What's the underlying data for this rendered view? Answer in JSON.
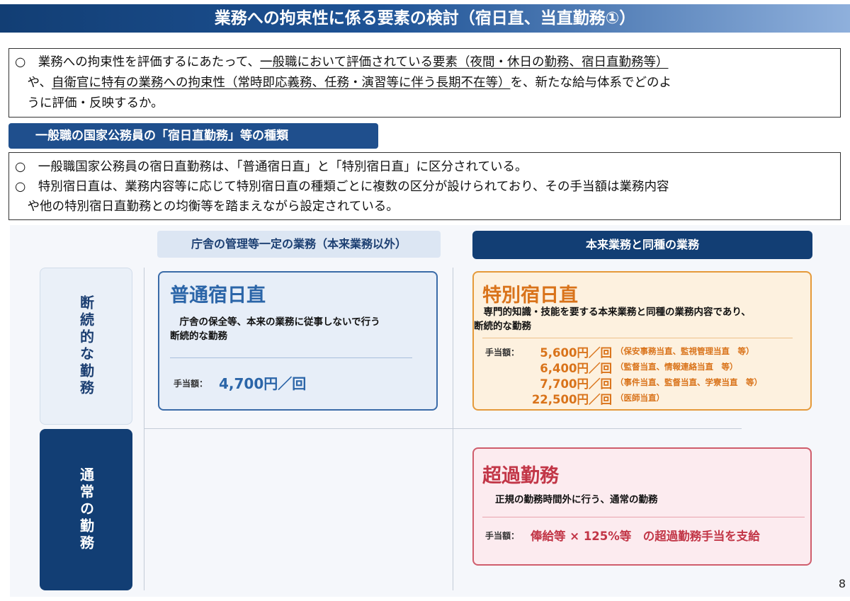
{
  "header": {
    "title": "業務への拘束性に係る要素の検討（宿日直、当直勤務①）"
  },
  "intro": {
    "line1_pre": "○　業務への拘束性を評価するにあたって、",
    "line1_underline": "一般職において評価されている要素（夜間・休日の勤務、宿日直勤務等）",
    "line2_pre": "　や、",
    "line2_underline": "自衛官に特有の業務への拘束性（常時即応義務、任務・演習等に伴う長期不在等）",
    "line2_post": "を、新たな給与体系でどのよ",
    "line3": "　うに評価・反映するか。"
  },
  "section": {
    "header": "一般職の国家公務員の「宿日直勤務」等の種類"
  },
  "info": {
    "line1": "○　一般職国家公務員の宿日直勤務は、「普通宿日直」と「特別宿日直」に区分されている。",
    "line2": "○　特別宿日直は、業務内容等に応じて特別宿日直の種類ごとに複数の区分が設けられており、その手当額は業務内容",
    "line3": "　や他の特別宿日直勤務との均衡等を踏まえながら設定されている。"
  },
  "matrix": {
    "col_left": "庁舎の管理等一定の業務（本来業務以外）",
    "col_right": "本来業務と同種の業務",
    "row_top": "断続的な勤務",
    "row_bottom": "通常の勤務"
  },
  "futsu": {
    "title": "普通宿日直",
    "desc1": "　庁舎の保全等、本来の業務に従事しないで行う",
    "desc2": "断続的な勤務",
    "allowance_label": "手当額：",
    "allowance_value": "4,700円／回"
  },
  "tokubetsu": {
    "title": "特別宿日直",
    "desc1": "　専門的知識・技能を要する本来業務と同種の業務内容であり、",
    "desc2": "断続的な勤務",
    "allowance_label": "手当額：",
    "rates": [
      {
        "amount": "5,600円／回",
        "note": "（保安事務当直、監視管理当直　等）"
      },
      {
        "amount": "6,400円／回",
        "note": "（監督当直、情報連絡当直　等）"
      },
      {
        "amount": "7,700円／回",
        "note": "（事件当直、監督当直、学寮当直　等）"
      },
      {
        "amount": "22,500円／回",
        "note": "（医師当直）"
      }
    ]
  },
  "choka": {
    "title": "超過勤務",
    "desc": "正規の勤務時間外に行う、通常の勤務",
    "allowance_label": "手当額：",
    "allowance_value": "俸給等 × 125%等　の超過勤務手当を支給"
  },
  "page_number": "8",
  "colors": {
    "navy": "#123e74",
    "blue_text": "#2b65a8",
    "orange_text": "#d9731a",
    "red_text": "#c23647"
  }
}
